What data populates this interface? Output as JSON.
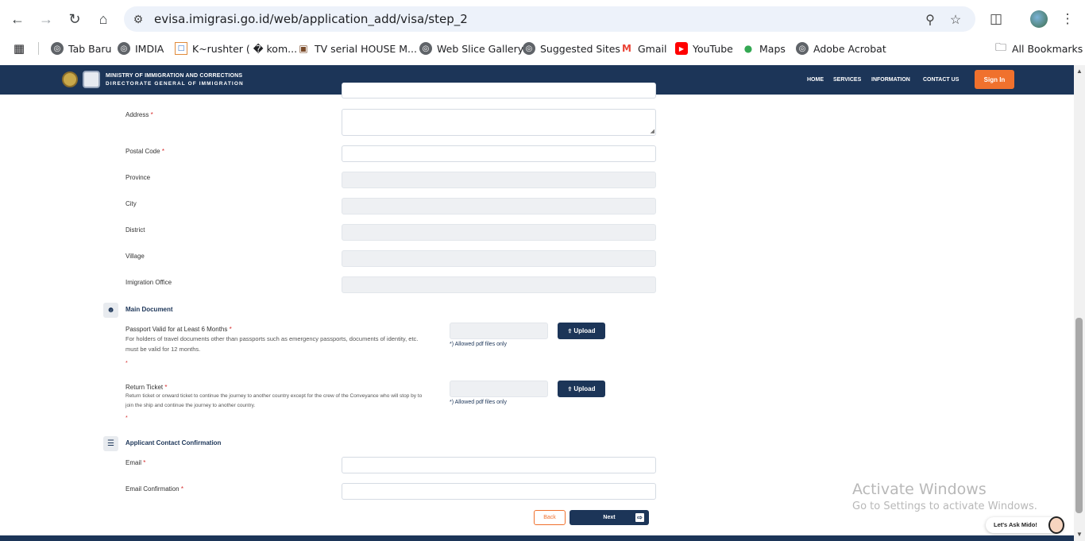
{
  "browser": {
    "url": "evisa.imigrasi.go.id/web/application_add/visa/step_2",
    "bookmarks": [
      "Tab Baru",
      "IMDIA",
      "K~rushter ( � kom...",
      "TV serial HOUSE M...",
      "Web Slice Gallery",
      "Suggested Sites",
      "Gmail",
      "YouTube",
      "Maps",
      "Adobe Acrobat"
    ],
    "all_bookmarks": "All Bookmarks"
  },
  "site": {
    "org_line1": "MINISTRY OF IMMIGRATION AND CORRECTIONS",
    "org_line2": "DIRECTORATE GENERAL OF IMMIGRATION",
    "nav": [
      "HOME",
      "SERVICES",
      "INFORMATION",
      "CONTACT US"
    ],
    "signin": "Sign In"
  },
  "form": {
    "address_label": "Address",
    "postal_label": "Postal Code",
    "province_label": "Province",
    "city_label": "City",
    "district_label": "District",
    "village_label": "Village",
    "office_label": "Imigration Office",
    "required_mark": "*"
  },
  "main_document": {
    "title": "Main Document",
    "passport_title": "Passport Valid for at Least 6 Months",
    "passport_desc": "For holders of travel documents other than passports such as emergency passports, documents of identity, etc. must be valid for 12 months.",
    "ticket_title": "Return Ticket",
    "ticket_desc": "Return ticket or onward ticket to continue the journey to another country except for the crew of the Conveyance who will stop by to join the ship and continue the journey to another country.",
    "upload_label": "Upload",
    "allowed": "*) Allowed pdf files only"
  },
  "contact": {
    "title": "Applicant Contact Confirmation",
    "email_label": "Email",
    "email_confirm_label": "Email Confirmation"
  },
  "actions": {
    "back": "Back",
    "next": "Next"
  },
  "overlay": {
    "activate_title": "Activate Windows",
    "activate_sub": "Go to Settings to activate Windows.",
    "chat": "Let's Ask Mido!"
  },
  "colors": {
    "brand_navy": "#1c3558",
    "accent_orange": "#f0712d"
  }
}
